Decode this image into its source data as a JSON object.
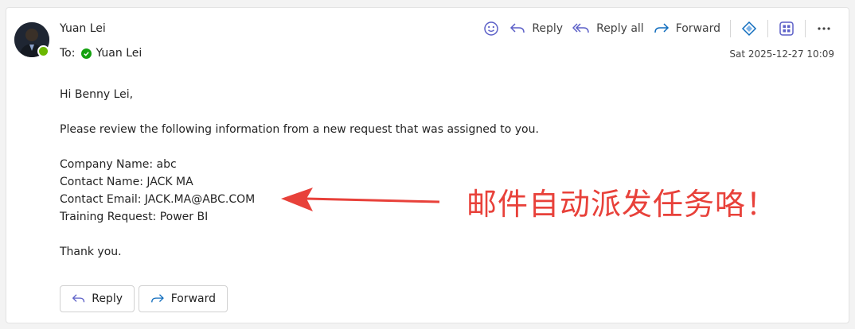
{
  "sender": {
    "name": "Yuan Lei",
    "presence": "available"
  },
  "recipients": {
    "label": "To:",
    "name": "Yuan Lei"
  },
  "timestamp": "Sat 2025-12-27 10:09",
  "toolbar": {
    "reply_label": "Reply",
    "reply_all_label": "Reply all",
    "forward_label": "Forward",
    "icons": [
      "emoji-icon",
      "reply-icon",
      "reply-all-icon",
      "forward-icon",
      "copilot-icon",
      "apps-icon",
      "more-icon"
    ]
  },
  "body": {
    "greeting": "Hi Benny Lei,",
    "intro": "Please review the following information from a new request that was assigned to you.",
    "fields": [
      "Company Name: abc",
      "Contact Name: JACK MA",
      "Contact Email: JACK.MA@ABC.COM",
      "Training Request: Power BI"
    ],
    "closing": "Thank you."
  },
  "bottom_actions": {
    "reply_label": "Reply",
    "forward_label": "Forward"
  },
  "annotation": {
    "text": "邮件自动派发任务咯！",
    "color": "#e8413a"
  },
  "colors": {
    "accent_purple": "#5b5fc7",
    "presence_green": "#6bb700",
    "annotation_red": "#e8413a"
  }
}
